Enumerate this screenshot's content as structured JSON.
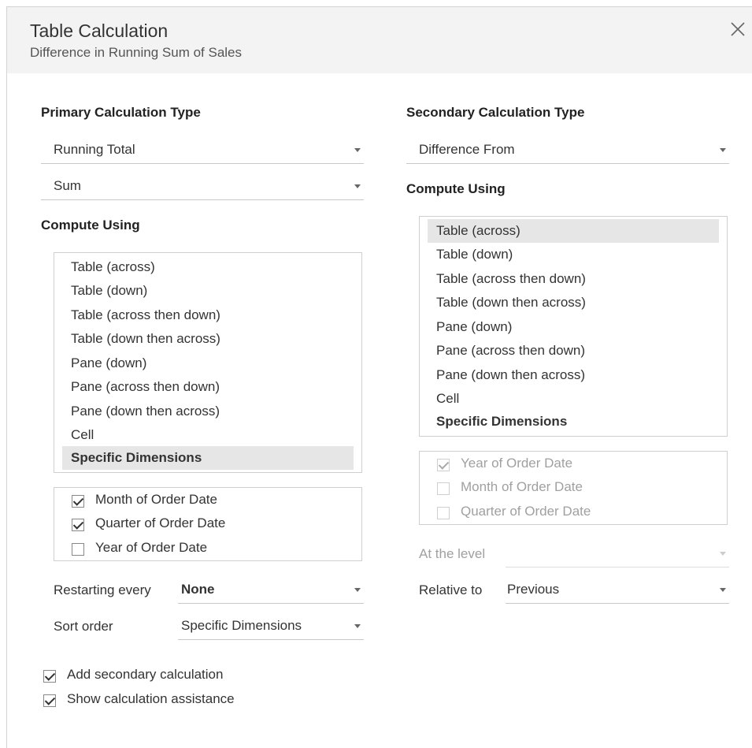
{
  "header": {
    "title": "Table Calculation",
    "subtitle": "Difference in Running Sum of Sales"
  },
  "primary": {
    "heading": "Primary Calculation Type",
    "type_value": "Running Total",
    "agg_value": "Sum",
    "compute_heading": "Compute Using",
    "compute_items": [
      "Table (across)",
      "Table (down)",
      "Table (across then down)",
      "Table (down then across)",
      "Pane (down)",
      "Pane (across then down)",
      "Pane (down then across)",
      "Cell",
      "Specific Dimensions"
    ],
    "dimensions": [
      {
        "label": "Month of Order Date",
        "checked": true
      },
      {
        "label": "Quarter of Order Date",
        "checked": true
      },
      {
        "label": "Year of Order Date",
        "checked": false
      }
    ],
    "restarting_label": "Restarting every",
    "restarting_value": "None",
    "sort_label": "Sort order",
    "sort_value": "Specific Dimensions"
  },
  "secondary": {
    "heading": "Secondary Calculation Type",
    "type_value": "Difference From",
    "compute_heading": "Compute Using",
    "compute_items": [
      "Table (across)",
      "Table (down)",
      "Table (across then down)",
      "Table (down then across)",
      "Pane (down)",
      "Pane (across then down)",
      "Pane (down then across)",
      "Cell",
      "Specific Dimensions"
    ],
    "dimensions": [
      {
        "label": "Year of Order Date",
        "checked": true
      },
      {
        "label": "Month of Order Date",
        "checked": false
      },
      {
        "label": "Quarter of Order Date",
        "checked": false
      }
    ],
    "level_label": "At the level",
    "level_value": "",
    "relative_label": "Relative to",
    "relative_value": "Previous"
  },
  "options": {
    "add_secondary": "Add secondary calculation",
    "show_assistance": "Show calculation assistance"
  }
}
